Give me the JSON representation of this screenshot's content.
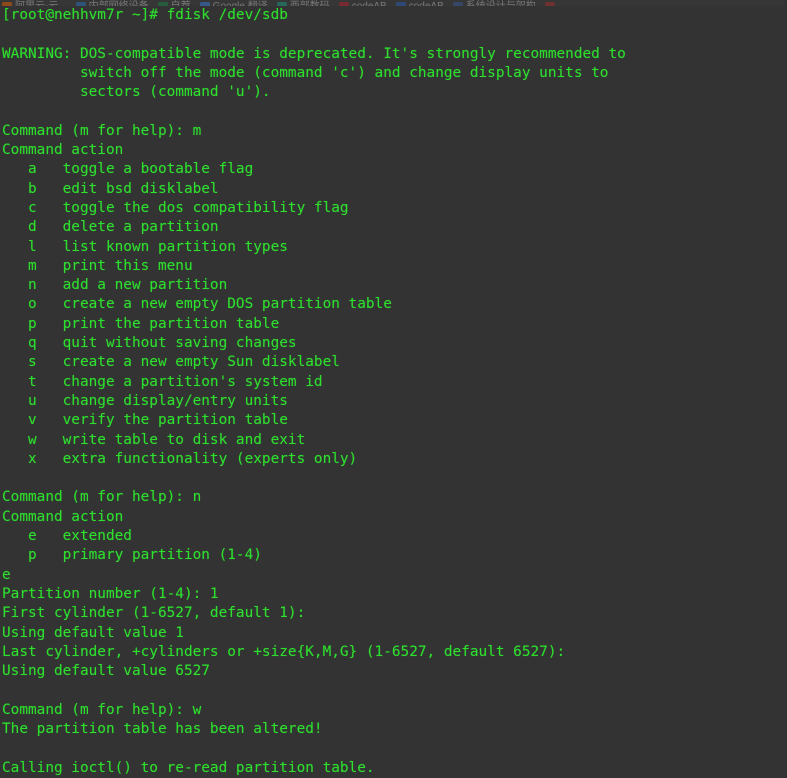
{
  "browser": {
    "bookmarks": [
      {
        "label": "阿里云-云...",
        "icon": "cloud-icon",
        "color": "#f60"
      },
      {
        "label": "内部网络设备",
        "icon": "network-icon",
        "color": "#2b7cd3"
      },
      {
        "label": "自荐",
        "icon": "star-icon",
        "color": "#1a8f4a"
      },
      {
        "label": "Google 翻译",
        "icon": "translate-icon",
        "color": "#4285f4"
      },
      {
        "label": "西部数码",
        "icon": "west-icon",
        "color": "#17a98c"
      },
      {
        "label": "codeAB",
        "icon": "codeab-red-icon",
        "color": "#cc2229"
      },
      {
        "label": "codeAB",
        "icon": "codeab-blue-icon",
        "color": "#2b62c6"
      },
      {
        "label": "系统设计与架构",
        "icon": "架构-icon",
        "color": "#3b5fa8"
      },
      {
        "label": "",
        "icon": "opera-icon",
        "color": "#b5302c"
      }
    ]
  },
  "terminal": {
    "foreground_color": "#2ee02e",
    "background_color": "#333333",
    "prompt": "[root@nehhvm7r ~]#",
    "command": "fdisk /dev/sdb",
    "lines": [
      "[root@nehhvm7r ~]# fdisk /dev/sdb",
      "",
      "WARNING: DOS-compatible mode is deprecated. It's strongly recommended to",
      "         switch off the mode (command 'c') and change display units to",
      "         sectors (command 'u').",
      "",
      "Command (m for help): m",
      "Command action",
      "   a   toggle a bootable flag",
      "   b   edit bsd disklabel",
      "   c   toggle the dos compatibility flag",
      "   d   delete a partition",
      "   l   list known partition types",
      "   m   print this menu",
      "   n   add a new partition",
      "   o   create a new empty DOS partition table",
      "   p   print the partition table",
      "   q   quit without saving changes",
      "   s   create a new empty Sun disklabel",
      "   t   change a partition's system id",
      "   u   change display/entry units",
      "   v   verify the partition table",
      "   w   write table to disk and exit",
      "   x   extra functionality (experts only)",
      "",
      "Command (m for help): n",
      "Command action",
      "   e   extended",
      "   p   primary partition (1-4)",
      "e",
      "Partition number (1-4): 1",
      "First cylinder (1-6527, default 1):",
      "Using default value 1",
      "Last cylinder, +cylinders or +size{K,M,G} (1-6527, default 6527):",
      "Using default value 6527",
      "",
      "Command (m for help): w",
      "The partition table has been altered!",
      "",
      "Calling ioctl() to re-read partition table."
    ]
  }
}
